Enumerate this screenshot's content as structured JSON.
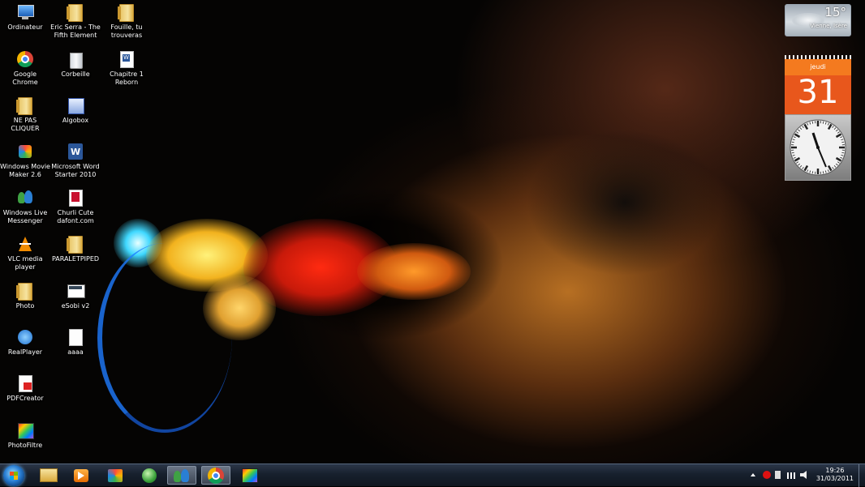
{
  "desktop": {
    "icons": [
      {
        "label": "Ordinateur",
        "name": "ordinateur-icon",
        "type": "computer"
      },
      {
        "label": "Eric Serra - The\nFifth Element",
        "name": "eric-serra-folder-icon",
        "type": "folder"
      },
      {
        "label": "Fouille, tu\ntrouveras",
        "name": "fouille-folder-icon",
        "type": "folder"
      },
      {
        "label": "Google Chrome",
        "name": "google-chrome-icon",
        "type": "chrome"
      },
      {
        "label": "Corbeille",
        "name": "recycle-bin-icon",
        "type": "bin"
      },
      {
        "label": "Chapitre 1\nReborn",
        "name": "chapitre-word-doc-icon",
        "type": "worddoc"
      },
      {
        "label": "NE PAS CLIQUER",
        "name": "ne-pas-cliquer-folder-icon",
        "type": "folder"
      },
      {
        "label": "Algobox",
        "name": "algobox-icon",
        "type": "algobox"
      },
      {
        "label": "Windows Movie\nMaker 2.6",
        "name": "movie-maker-icon",
        "type": "moviemaker"
      },
      {
        "label": "Microsoft Word\nStarter 2010",
        "name": "word-starter-icon",
        "type": "word"
      },
      {
        "label": "Windows Live\nMessenger",
        "name": "live-messenger-icon",
        "type": "messenger"
      },
      {
        "label": "Churli Cute\ndafont.com",
        "name": "churli-cute-font-icon",
        "type": "pdf"
      },
      {
        "label": "VLC media\nplayer",
        "name": "vlc-icon",
        "type": "vlc"
      },
      {
        "label": "PARALETPIPED",
        "name": "paraletpiped-folder-icon",
        "type": "folder"
      },
      {
        "label": "Photo",
        "name": "photo-folder-icon",
        "type": "folder"
      },
      {
        "label": "eSobi v2",
        "name": "esobi-icon",
        "type": "news"
      },
      {
        "label": "RealPlayer",
        "name": "realplayer-icon",
        "type": "realplayer"
      },
      {
        "label": "aaaa",
        "name": "aaaa-file-icon",
        "type": "blank"
      },
      {
        "label": "PDFCreator",
        "name": "pdfcreator-icon",
        "type": "pdfcreator"
      },
      {
        "label": "PhotoFiltre",
        "name": "photofiltre-icon",
        "type": "photofiltre"
      }
    ]
  },
  "gadgets": {
    "weather": {
      "temperature": "15°",
      "location": "Vienne, Isère"
    },
    "calendar": {
      "day_name": "jeudi",
      "day_number": "31"
    }
  },
  "taskbar": {
    "buttons": [
      {
        "name": "explorer-taskbar-icon",
        "active": false
      },
      {
        "name": "media-player-taskbar-icon",
        "active": false
      },
      {
        "name": "movie-maker-taskbar-icon",
        "active": false
      },
      {
        "name": "green-globe-taskbar-icon",
        "active": false
      },
      {
        "name": "messenger-taskbar-icon",
        "active": true
      },
      {
        "name": "chrome-taskbar-icon",
        "active": true
      },
      {
        "name": "photofiltre-taskbar-icon",
        "active": false
      }
    ],
    "time": "19:26",
    "date": "31/03/2011"
  },
  "colors": {
    "taskbar": "#17202d",
    "calendar_orange": "#e8571c",
    "calendar_header": "#f47a1f"
  }
}
